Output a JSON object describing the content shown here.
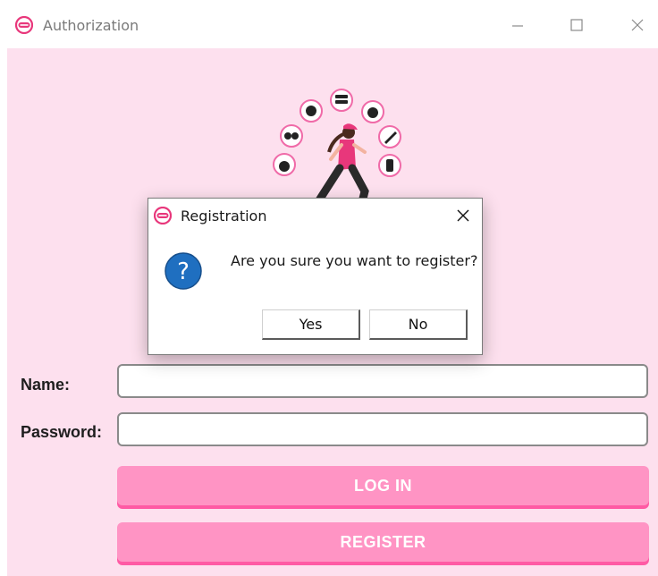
{
  "window": {
    "title": "Authorization"
  },
  "form": {
    "name_label": "Name:",
    "password_label": "Password:",
    "name_value": "",
    "password_value": "",
    "login_label": "LOG IN",
    "register_label": "REGISTER"
  },
  "dialog": {
    "title": "Registration",
    "message": "Are you sure you want to register?",
    "yes_label": "Yes",
    "no_label": "No"
  },
  "colors": {
    "background": "#fde0ee",
    "button": "#ff94c4",
    "button_shadow": "#ff5aa4",
    "icon_accent": "#e8377b",
    "question_icon": "#1f6fc0"
  }
}
